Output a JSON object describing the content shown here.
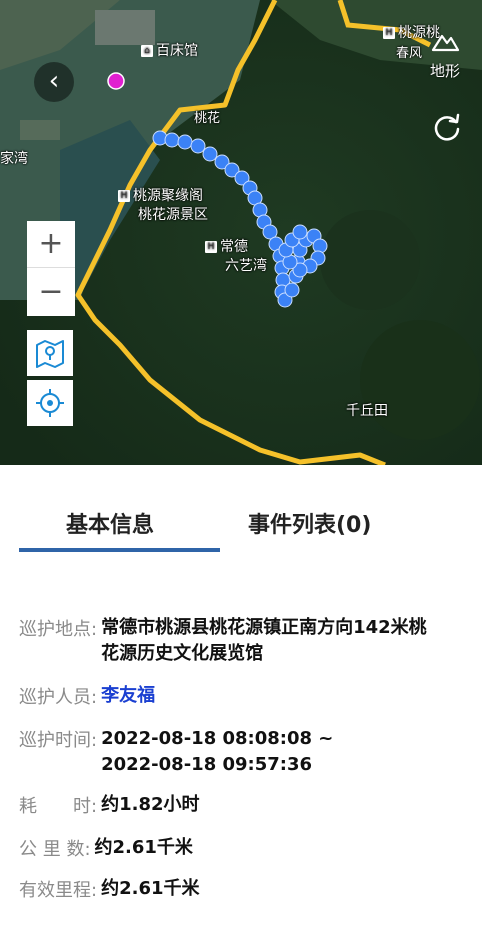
{
  "map": {
    "labels": {
      "baichuangguan": "百床馆",
      "jiawan": "家湾",
      "taoyuanju": "桃源聚缘阁",
      "taohuajingqu": "桃花源景区",
      "changde": "常德",
      "liuyiwan": "六艺湾",
      "qianqiutian": "千丘田",
      "taoyuantao": "桃源桃",
      "chunfeng": "春风",
      "taohua_partial": "桃花"
    },
    "terrain_label": "地形"
  },
  "tabs": {
    "basic": "基本信息",
    "events": "事件列表(0)"
  },
  "info": {
    "location_label": "巡护地点:",
    "location_value": "常德市桃源县桃花源镇正南方向142米桃花源历史文化展览馆",
    "person_label": "巡护人员:",
    "person_value": "李友福",
    "time_label": "巡护时间:",
    "time_value": "2022-08-18 08:08:08 ~ 2022-08-18 09:57:36",
    "duration_label": "耗　　时:",
    "duration_value": "约1.82小时",
    "distance_label": "公 里 数:",
    "distance_value": "约2.61千米",
    "effective_label": "有效里程:",
    "effective_value": "约2.61千米"
  },
  "colors": {
    "tab_indicator": "#2f64a8",
    "person_link": "#1a3fd1",
    "track": "#3b82f6",
    "boundary": "#f5c12a"
  }
}
